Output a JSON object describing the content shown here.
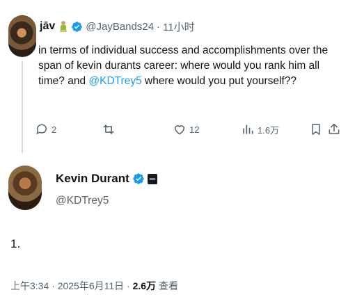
{
  "original_tweet": {
    "display_name": "jāv",
    "handle": "@JayBands24",
    "separator": "·",
    "time": "11小时",
    "text_plain_1": "in terms of individual success and accomplishments over the span of kevin durants career: where would you rank him all time? and ",
    "mention": "@KDTrey5",
    "text_plain_2": " where would you put yourself??",
    "actions": {
      "reply_count": "2",
      "retweet_count": "",
      "like_count": "12",
      "views_count": "1.6万"
    }
  },
  "reply_tweet": {
    "display_name": "Kevin Durant",
    "handle": "@KDTrey5",
    "text": "1.",
    "timestamp": "上午3:34 · 2025年6月11日 · ",
    "views_value": "2.6万",
    "views_label": " 查看"
  },
  "colors": {
    "accent": "#1d9bf0",
    "muted": "#536471",
    "text": "#0f1419",
    "divider": "#cfd9de"
  },
  "icons": [
    "reply-icon",
    "retweet-icon",
    "like-icon",
    "views-icon",
    "bookmark-icon",
    "share-icon",
    "verified-badge-icon",
    "person-emoji-icon",
    "square-badge-icon"
  ]
}
